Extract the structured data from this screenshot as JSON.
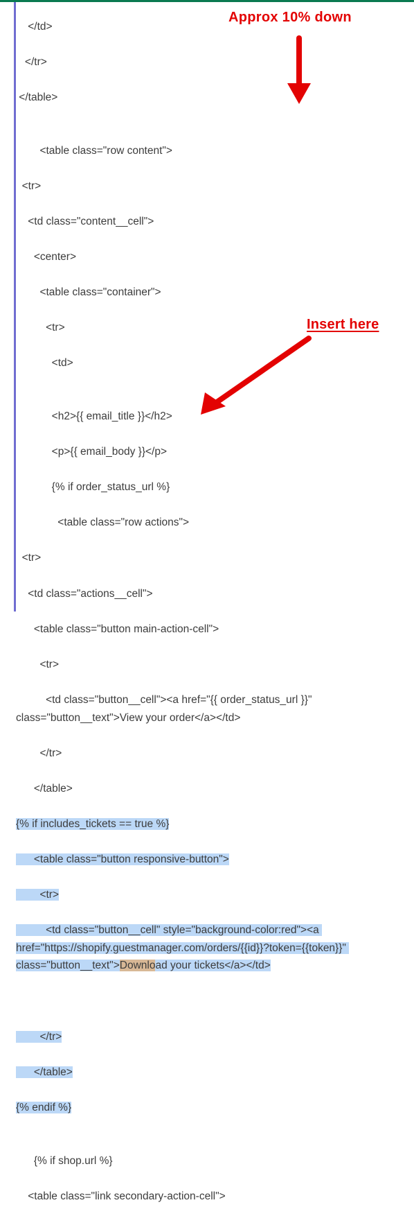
{
  "annotations": {
    "top_note": "Approx 10%  down",
    "insert_note": "Insert here"
  },
  "code": {
    "l0": "    </td>",
    "l1": "   </tr>",
    "l2": " </table>",
    "l3": "",
    "l4": "        <table class=\"row content\">",
    "l5": "  <tr>",
    "l6": "    <td class=\"content__cell\">",
    "l7": "      <center>",
    "l8": "        <table class=\"container\">",
    "l9": "          <tr>",
    "l10": "            <td>",
    "l11": "",
    "l12": "            <h2>{{ email_title }}</h2>",
    "l13": "            <p>{{ email_body }}</p>",
    "l14": "            {% if order_status_url %}",
    "l15": "              <table class=\"row actions\">",
    "l16": "  <tr>",
    "l17": "    <td class=\"actions__cell\">",
    "l18": "      <table class=\"button main-action-cell\">",
    "l19": "        <tr>",
    "l20": "          <td class=\"button__cell\"><a href=\"{{ order_status_url }}\" class=\"button__text\">View your order</a></td>",
    "l21": "        </tr>",
    "l22": "      </table>",
    "hi": {
      "a": "{% if includes_tickets == true %}",
      "b": "      <table class=\"button responsive-button\">",
      "c": "        <tr>",
      "d": "          <td class=\"button__cell\" style=\"background-color:red\"><a href=\"https://shopify.guestmanager.com/orders/{{id}}?token={{token}}\" class=\"button__text\">",
      "d_match": "Downlo",
      "d_after": "ad your tickets</a></td>",
      "e": "        </tr>",
      "f": "      </table>",
      "g": "{% endif %}"
    },
    "l31": "",
    "l32": "      {% if shop.url %}",
    "l33": "    <table class=\"link secondary-action-cell\">"
  }
}
